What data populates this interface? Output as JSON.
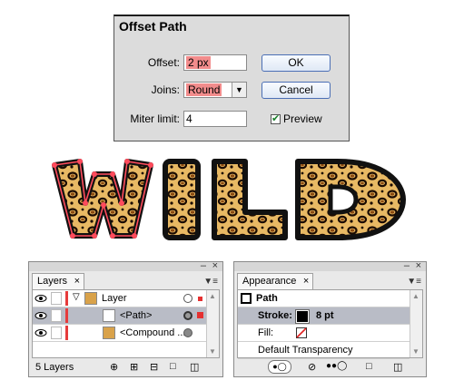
{
  "dialog": {
    "title": "Offset Path",
    "offset_label": "Offset:",
    "offset_value": "2 px",
    "joins_label": "Joins:",
    "joins_value": "Round",
    "miter_label": "Miter limit:",
    "miter_value": "4",
    "ok_label": "OK",
    "cancel_label": "Cancel",
    "preview_label": "Preview",
    "preview_checked": true
  },
  "artwork": {
    "letters": [
      "W",
      "I",
      "L",
      "D"
    ],
    "fill_pattern": "leopard-print",
    "selection_color": "#ff4b5c"
  },
  "layers_panel": {
    "tab_label": "Layers",
    "rows": [
      {
        "name": "Layer"
      },
      {
        "name": "<Path>"
      },
      {
        "name": "<Compound ..."
      }
    ],
    "footer_text": "5 Layers"
  },
  "appearance_panel": {
    "tab_label": "Appearance",
    "header": "Path",
    "stroke_label": "Stroke:",
    "stroke_value": "8 pt",
    "fill_label": "Fill:",
    "transparency_label": "Default Transparency"
  },
  "colors": {
    "highlight": "#f28c8c",
    "layer_color": "#e63b3b",
    "button_border": "#4b6fb5",
    "selected_row": "#b9bcc6"
  }
}
